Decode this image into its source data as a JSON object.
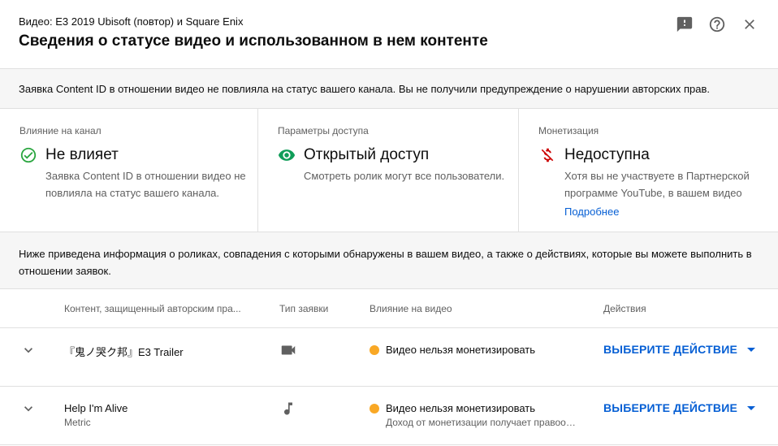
{
  "header": {
    "video_line": "Видео: E3 2019 Ubisoft (повтор) и Square Enix",
    "title": "Сведения о статусе видео и использованном в нем контенте",
    "icons": [
      "feedback-icon",
      "help-icon",
      "close-icon"
    ]
  },
  "notice": {
    "text": "Заявка Content ID в отношении видео не повлияла на статус вашего канала. Вы не получили предупреждение о нарушении авторских прав."
  },
  "cards": [
    {
      "label": "Влияние на канал",
      "value": "Не влияет",
      "description": "Заявка Content ID в отношении видео не повлияла на статус вашего канала.",
      "icon": "check-circle-icon",
      "color": "#2ba640"
    },
    {
      "label": "Параметры доступа",
      "value": "Открытый доступ",
      "description": "Смотреть ролик могут все пользователи.",
      "icon": "eye-icon",
      "color": "#0f9d58"
    },
    {
      "label": "Монетизация",
      "value": "Недоступна",
      "description": "Хотя вы не участвуете в Партнерской программе YouTube, в вашем видео",
      "link": "Подробнее",
      "icon": "money-off-icon",
      "color": "#cc0000"
    }
  ],
  "info": {
    "text": "Ниже приведена информация о роликах, совпадения с которыми обнаружены в вашем видео, а также о действиях, которые вы можете выполнить в отношении заявок."
  },
  "table": {
    "columns": [
      "Контент, защищенный авторским пра...",
      "Тип заявки",
      "Влияние на видео",
      "Действия"
    ],
    "rows": [
      {
        "title": "『鬼ノ哭ク邦』E3 Trailer",
        "subtitle": "",
        "type_icon": "video-camera-icon",
        "impact": "Видео нельзя монетизировать",
        "impact_sub": "",
        "action": "ВЫБЕРИТЕ ДЕЙСТВИЕ"
      },
      {
        "title": "Help I'm Alive",
        "subtitle": "Metric",
        "type_icon": "music-note-icon",
        "impact": "Видео нельзя монетизировать",
        "impact_sub": "Доход от монетизации получает правообладатель",
        "action": "ВЫБЕРИТЕ ДЕЙСТВИЕ"
      }
    ],
    "status_color": "#f9a825",
    "action_color": "#065fd4"
  }
}
